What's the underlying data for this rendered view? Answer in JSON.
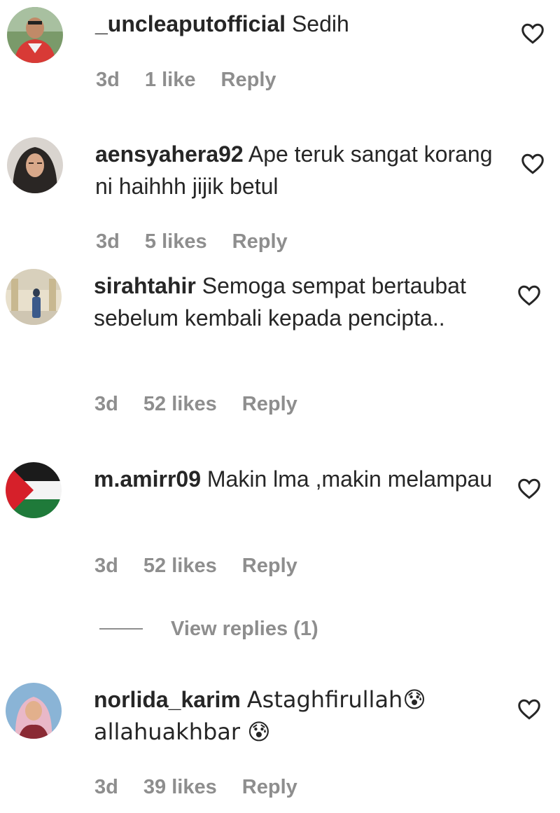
{
  "comments": [
    {
      "username": "_uncleaputofficial",
      "text": "Sedih",
      "time": "3d",
      "likes": "1 like",
      "reply": "Reply"
    },
    {
      "username": "aensyahera92",
      "text": "Ape teruk sangat korang ni haihhh jijik betul",
      "time": "3d",
      "likes": "5 likes",
      "reply": "Reply"
    },
    {
      "username": "sirahtahir",
      "text": "Semoga sempat bertaubat sebelum kembali kepada pencipta..",
      "time": "3d",
      "likes": "52 likes",
      "reply": "Reply"
    },
    {
      "username": "m.amirr09",
      "text": "Makin lma ,makin melampau",
      "time": "3d",
      "likes": "52 likes",
      "reply": "Reply"
    },
    {
      "username": "norlida_karim",
      "text": "Astaghfirullah😰 allahuakhbar 😰",
      "time": "3d",
      "likes": "39 likes",
      "reply": "Reply"
    }
  ],
  "view_replies": "View replies (1)",
  "icons": {
    "like": "heart-icon"
  },
  "colors": {
    "text": "#262626",
    "meta": "#8e8e8e"
  }
}
